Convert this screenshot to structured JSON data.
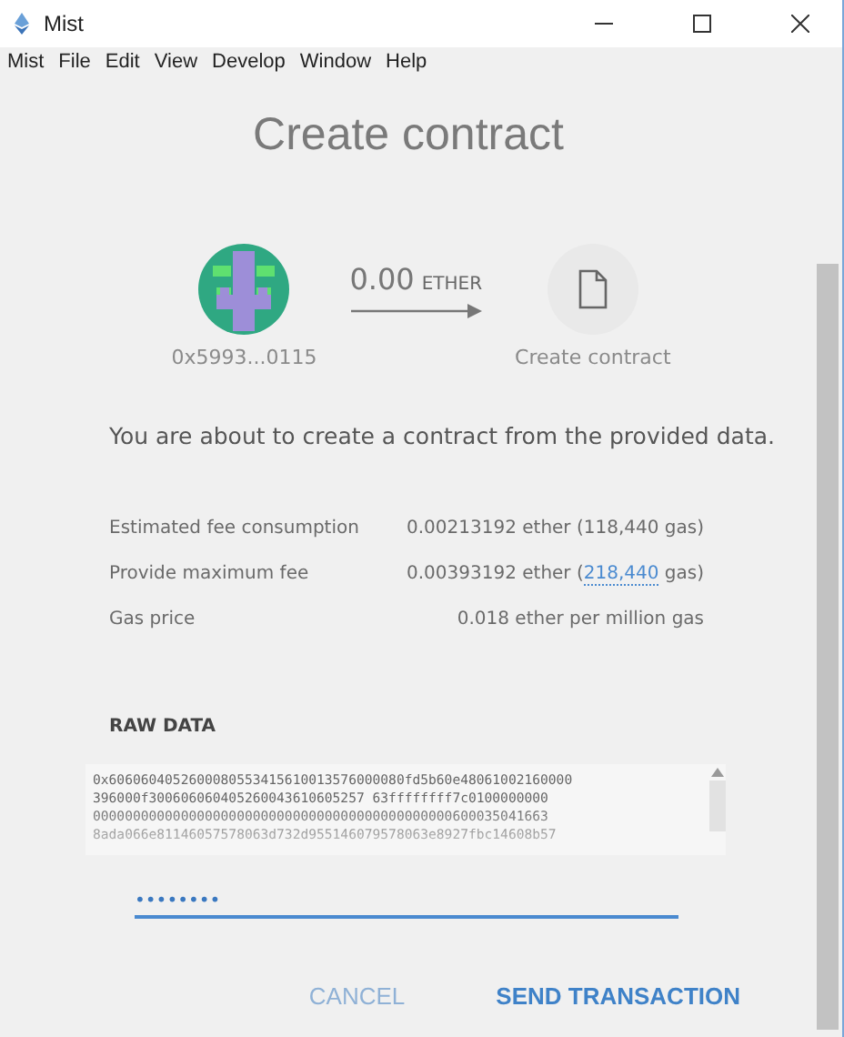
{
  "window": {
    "title": "Mist"
  },
  "menu": [
    "Mist",
    "File",
    "Edit",
    "View",
    "Develop",
    "Window",
    "Help"
  ],
  "heading": "Create contract",
  "from": {
    "address": "0x5993...0115"
  },
  "amount": {
    "value": "0.00",
    "unit": "ETHER"
  },
  "to": {
    "label": "Create contract"
  },
  "message": "You are about to create a contract from the provided data.",
  "fees": [
    {
      "label": "Estimated fee consumption",
      "value": "0.00213192 ether (118,440 gas)"
    },
    {
      "label": "Provide maximum fee",
      "value": "0.00393192 ether (",
      "link": "218,440",
      "after": " gas)"
    },
    {
      "label": "Gas price",
      "value": "0.018 ether per million gas"
    }
  ],
  "raw_data": {
    "title": "RAW DATA",
    "lines": [
      "0x6060604052600080553415610013576000080fd5b60e48061002160000",
      "396000f300606060405260043610605257 63ffffffff7c0100000000",
      "000000000000000000000000000000000000000000000600035041663",
      "8ada066e81146057578063d732d955146079578063e8927fbc14608b57"
    ]
  },
  "password": {
    "value": "••••••••"
  },
  "buttons": [
    {
      "label": "CANCEL",
      "kind": "secondary"
    },
    {
      "label": "SEND TRANSACTION",
      "kind": "primary"
    }
  ]
}
